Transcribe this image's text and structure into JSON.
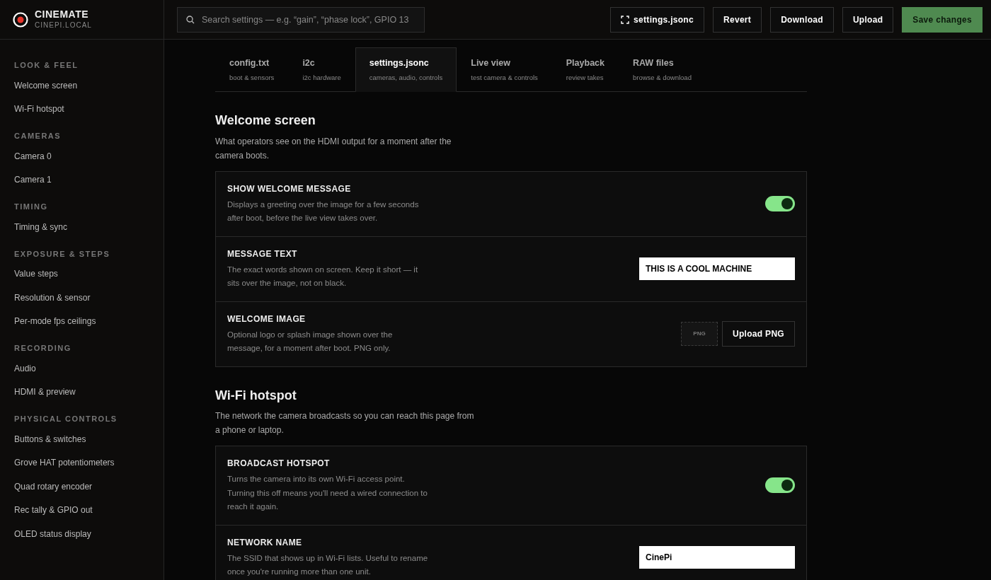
{
  "brand": {
    "title": "CINEMATE",
    "subtitle": "CINEPI.LOCAL"
  },
  "search": {
    "placeholder": "Search settings — e.g. “gain”, “phase lock”, GPIO 13"
  },
  "toolbar": [
    {
      "label": "settings.jsonc",
      "kind": "file"
    },
    {
      "label": "Revert",
      "kind": "plain"
    },
    {
      "label": "Download",
      "kind": "plain"
    },
    {
      "label": "Upload",
      "kind": "plain"
    },
    {
      "label": "Save changes",
      "kind": "primary"
    }
  ],
  "sidebar": [
    {
      "heading": "LOOK & FEEL",
      "items": [
        "Welcome screen",
        "Wi-Fi hotspot"
      ]
    },
    {
      "heading": "CAMERAS",
      "items": [
        "Camera 0",
        "Camera 1"
      ]
    },
    {
      "heading": "TIMING",
      "items": [
        "Timing & sync"
      ]
    },
    {
      "heading": "EXPOSURE & STEPS",
      "items": [
        "Value steps",
        "Resolution & sensor",
        "Per-mode fps ceilings"
      ]
    },
    {
      "heading": "RECORDING",
      "items": [
        "Audio",
        "HDMI & preview"
      ]
    },
    {
      "heading": "PHYSICAL CONTROLS",
      "items": [
        "Buttons & switches",
        "Grove HAT potentiometers",
        "Quad rotary encoder",
        "Rec tally & GPIO out",
        "OLED status display"
      ]
    }
  ],
  "tabs": [
    {
      "label": "config.txt",
      "sub": "boot & sensors",
      "selected": false
    },
    {
      "label": "i2c",
      "sub": "i2c hardware",
      "selected": false
    },
    {
      "label": "settings.jsonc",
      "sub": "cameras, audio, controls",
      "selected": true
    },
    {
      "label": "Live view",
      "sub": "test camera & controls",
      "selected": false
    },
    {
      "label": "Playback",
      "sub": "review takes",
      "selected": false
    },
    {
      "label": "RAW files",
      "sub": "browse & download",
      "selected": false
    }
  ],
  "sections": [
    {
      "title": "Welcome screen",
      "description": "What operators see on the HDMI output for a moment after the camera boots.",
      "settings": [
        {
          "kind": "toggle",
          "label": "SHOW WELCOME MESSAGE",
          "description": "Displays a greeting over the image for a few seconds after boot, before the live view takes over.",
          "on": true
        },
        {
          "kind": "text",
          "label": "MESSAGE TEXT",
          "description": "The exact words shown on screen. Keep it short — it sits over the image, not on black.",
          "value": "THIS IS A COOL MACHINE"
        },
        {
          "kind": "image",
          "label": "WELCOME IMAGE",
          "description": "Optional logo or splash image shown over the message, for a moment after boot. PNG only.",
          "preview": "PNG",
          "button": "Upload PNG"
        }
      ]
    },
    {
      "title": "Wi-Fi hotspot",
      "description": "The network the camera broadcasts so you can reach this page from a phone or laptop.",
      "settings": [
        {
          "kind": "toggle",
          "label": "BROADCAST HOTSPOT",
          "description": "Turns the camera into its own Wi-Fi access point. Turning this off means you'll need a wired connection to reach it again.",
          "on": true
        },
        {
          "kind": "text",
          "label": "NETWORK NAME",
          "description": "The SSID that shows up in Wi-Fi lists. Useful to rename once you're running more than one unit.",
          "value": "CinePi"
        }
      ]
    }
  ]
}
